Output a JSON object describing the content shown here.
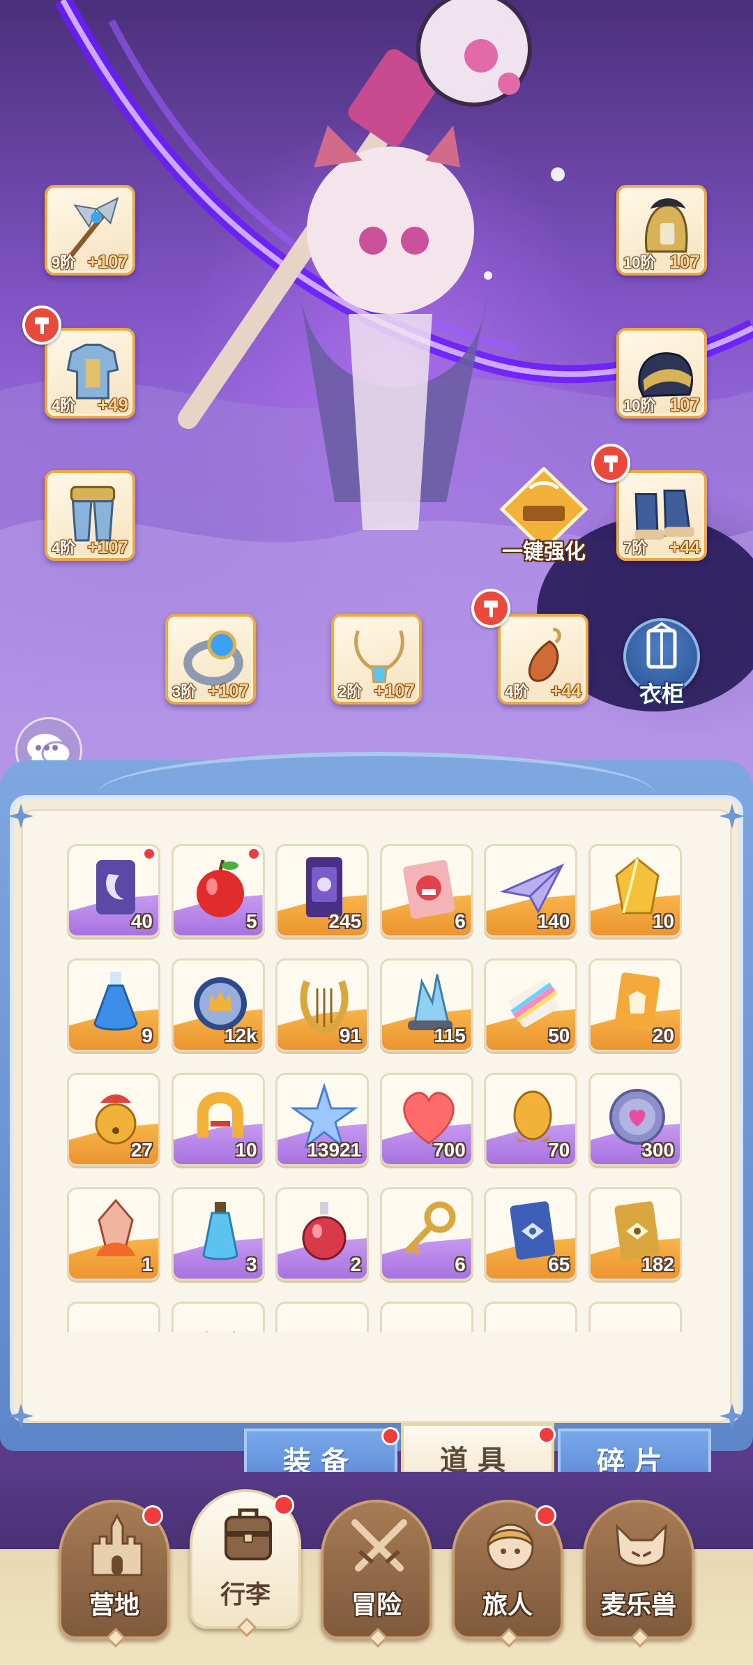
{
  "equipment": {
    "weapon": {
      "tier": "9阶",
      "bonus": "+107",
      "icon": "halberd-icon"
    },
    "helmet": {
      "tier": "10阶",
      "bonus": "107",
      "icon": "winged-helmet-icon"
    },
    "armor": {
      "tier": "4阶",
      "bonus": "+49",
      "icon": "chest-armor-icon",
      "upgradable": true
    },
    "headgear": {
      "tier": "10阶",
      "bonus": "107",
      "icon": "plumed-helm-icon"
    },
    "leggings": {
      "tier": "4阶",
      "bonus": "+107",
      "icon": "leg-armor-icon"
    },
    "boots": {
      "tier": "7阶",
      "bonus": "+44",
      "icon": "boots-icon",
      "upgradable": true
    },
    "ring": {
      "tier": "3阶",
      "bonus": "+107",
      "icon": "ring-icon"
    },
    "necklace": {
      "tier": "2阶",
      "bonus": "+107",
      "icon": "necklace-icon"
    },
    "charm": {
      "tier": "4阶",
      "bonus": "+44",
      "icon": "charm-icon",
      "upgradable": true
    }
  },
  "actions": {
    "upgrade_all": "一键强化",
    "wardrobe": "衣柜"
  },
  "items": [
    {
      "count": "40",
      "rarity": "purple",
      "icon": "moon-card-icon",
      "dot": true
    },
    {
      "count": "5",
      "rarity": "purple",
      "icon": "apple-icon",
      "dot": true
    },
    {
      "count": "245",
      "rarity": "orange",
      "icon": "ticket-icon",
      "dot": false
    },
    {
      "count": "6",
      "rarity": "orange",
      "icon": "monster-card-icon",
      "dot": false
    },
    {
      "count": "140",
      "rarity": "orange",
      "icon": "paper-plane-icon",
      "dot": false
    },
    {
      "count": "10",
      "rarity": "orange",
      "icon": "gold-crystal-icon",
      "dot": false
    },
    {
      "count": "9",
      "rarity": "orange",
      "icon": "blue-potion-icon",
      "dot": false
    },
    {
      "count": "12k",
      "rarity": "orange",
      "icon": "crown-orb-icon",
      "dot": false
    },
    {
      "count": "91",
      "rarity": "orange",
      "icon": "lyre-icon",
      "dot": false
    },
    {
      "count": "115",
      "rarity": "orange",
      "icon": "ice-crystal-icon",
      "dot": false
    },
    {
      "count": "50",
      "rarity": "orange",
      "icon": "paint-tube-icon",
      "dot": false
    },
    {
      "count": "20",
      "rarity": "orange",
      "icon": "outfit-card-icon",
      "dot": false
    },
    {
      "count": "27",
      "rarity": "orange",
      "icon": "bell-icon",
      "dot": false
    },
    {
      "count": "10",
      "rarity": "purple",
      "icon": "horseshoe-icon",
      "dot": false
    },
    {
      "count": "13921",
      "rarity": "purple",
      "icon": "star-crystal-icon",
      "dot": false
    },
    {
      "count": "700",
      "rarity": "purple",
      "icon": "heart-icon",
      "dot": false
    },
    {
      "count": "70",
      "rarity": "purple",
      "icon": "gold-egg-icon",
      "dot": false
    },
    {
      "count": "300",
      "rarity": "purple",
      "icon": "heart-coin-icon",
      "dot": false
    },
    {
      "count": "1",
      "rarity": "orange",
      "icon": "fire-crystal-icon",
      "dot": false
    },
    {
      "count": "3",
      "rarity": "purple",
      "icon": "water-bottle-icon",
      "dot": false
    },
    {
      "count": "2",
      "rarity": "purple",
      "icon": "red-potion-icon",
      "dot": false
    },
    {
      "count": "6",
      "rarity": "purple",
      "icon": "gold-key-icon",
      "dot": false
    },
    {
      "count": "65",
      "rarity": "orange",
      "icon": "blue-eye-card-icon",
      "dot": false
    },
    {
      "count": "182",
      "rarity": "orange",
      "icon": "gold-eye-card-icon",
      "dot": false
    },
    {
      "count": "",
      "rarity": "orange",
      "icon": "orange-item-icon",
      "dot": false
    },
    {
      "count": "",
      "rarity": "purple",
      "icon": "cat-item-icon",
      "dot": false
    },
    {
      "count": "",
      "rarity": "purple",
      "icon": "dome-item-icon",
      "dot": false
    },
    {
      "count": "",
      "rarity": "blue",
      "icon": "blue-item-icon",
      "dot": false
    },
    {
      "count": "",
      "rarity": "purple",
      "icon": "leaf-item-icon",
      "dot": false
    },
    {
      "count": "",
      "rarity": "purple",
      "icon": "fox-item-icon",
      "dot": false
    }
  ],
  "bag_tabs": [
    {
      "label": "装备",
      "active": false,
      "dot": true
    },
    {
      "label": "道具",
      "active": true,
      "dot": true
    },
    {
      "label": "碎片",
      "active": false,
      "dot": false
    }
  ],
  "nav": [
    {
      "label": "营地",
      "icon": "castle-icon",
      "active": false,
      "dot": true
    },
    {
      "label": "行李",
      "icon": "backpack-icon",
      "active": true,
      "dot": true
    },
    {
      "label": "冒险",
      "icon": "crossed-swords-icon",
      "active": false,
      "dot": false
    },
    {
      "label": "旅人",
      "icon": "hero-portrait-icon",
      "active": false,
      "dot": true
    },
    {
      "label": "麦乐兽",
      "icon": "fox-pet-icon",
      "active": false,
      "dot": false
    }
  ],
  "colors": {
    "accent_orange": "#ec9530",
    "accent_purple": "#a772e0",
    "accent_blue": "#5a89d3",
    "badge_red": "#ef3d3d",
    "panel_bg": "#faf5ea"
  }
}
